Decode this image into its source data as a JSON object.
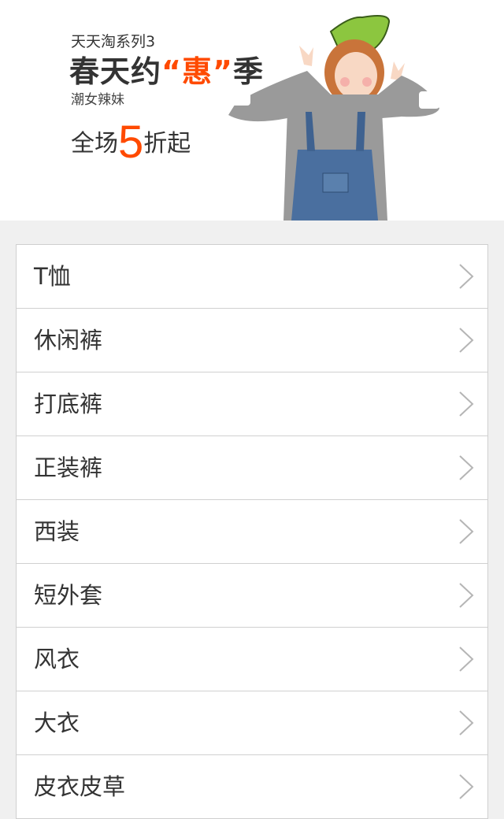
{
  "banner": {
    "series": "天天淘系列3",
    "headline_pre": "春天约",
    "headline_highlight": "“惠”",
    "headline_post": "季",
    "tagline": "潮女辣妹",
    "promo_pre": "全场",
    "promo_number": "5",
    "promo_post": "折起",
    "accent_color": "#ff4a00"
  },
  "categories": [
    {
      "label": "T恤"
    },
    {
      "label": "休闲裤"
    },
    {
      "label": "打底裤"
    },
    {
      "label": "正装裤"
    },
    {
      "label": "西装"
    },
    {
      "label": "短外套"
    },
    {
      "label": "风衣"
    },
    {
      "label": "大衣"
    },
    {
      "label": "皮衣皮草"
    }
  ],
  "icons": {
    "row_arrow": "chevron-right-icon"
  }
}
